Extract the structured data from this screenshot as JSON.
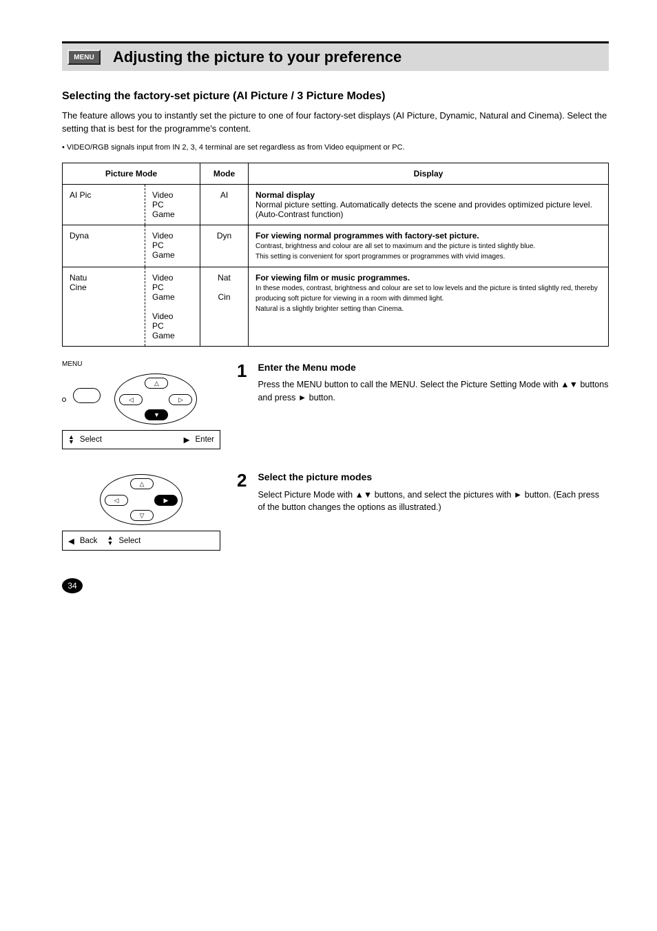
{
  "badge": "MENU",
  "title": "Adjusting the picture to your preference",
  "section_heading": "Selecting the factory-set picture (AI Picture / 3 Picture Modes)",
  "intro": "The feature allows you to instantly set the picture to one of four factory-set displays (AI Picture, Dynamic, Natural and Cinema). Select the setting that is best for the programme's content.",
  "note": "• VIDEO/RGB signals input from IN 2, 3, 4 terminal are set regardless as from Video equipment or PC.",
  "table": {
    "head": [
      "Picture Mode",
      "Mode",
      "Display"
    ],
    "rows": [
      {
        "labelA": "AI Pic",
        "labelB": "Video\nPC\nGame",
        "mode": "AI",
        "desc_head": "Normal display",
        "desc": "Normal picture setting. Automatically detects the scene and provides optimized picture level. (Auto-Contrast function)"
      },
      {
        "labelA": "Dyna",
        "labelB": "Video\nPC\nGame",
        "mode": "Dyn",
        "desc_head": "For viewing normal programmes with factory-set picture.",
        "desc": "Contrast, brightness and colour are all set to maximum and the picture is tinted slightly blue.\nThis setting is convenient for sport programmes or programmes with vivid images."
      },
      {
        "labelA": "Natu\nCine",
        "labelB": "Video\nPC\nGame\n\nVideo\nPC\nGame",
        "mode": "Nat\n\nCin",
        "desc_head": "For viewing film or music programmes.",
        "desc": "In these modes, contrast, brightness and colour are set to low levels and the picture is tinted slightly red, thereby producing soft picture for viewing in a room with dimmed light.\nNatural is a slightly brighter setting than Cinema."
      }
    ]
  },
  "steps": [
    {
      "num": "1",
      "heading": "Enter the Menu mode",
      "body": "Press the MENU button to call the MENU. Select the Picture Setting Mode with ▲▼ buttons and press ► button.",
      "captionLabel": "MENU",
      "instrLeft": "Select",
      "instrRight": "Enter"
    },
    {
      "num": "2",
      "heading": "Select the picture modes",
      "body": "Select Picture Mode with ▲▼ buttons, and select the pictures with ► button. (Each press of the button changes the options as illustrated.)",
      "instrLeft": "Back",
      "instrRight": "Select"
    }
  ],
  "page_number": "34"
}
